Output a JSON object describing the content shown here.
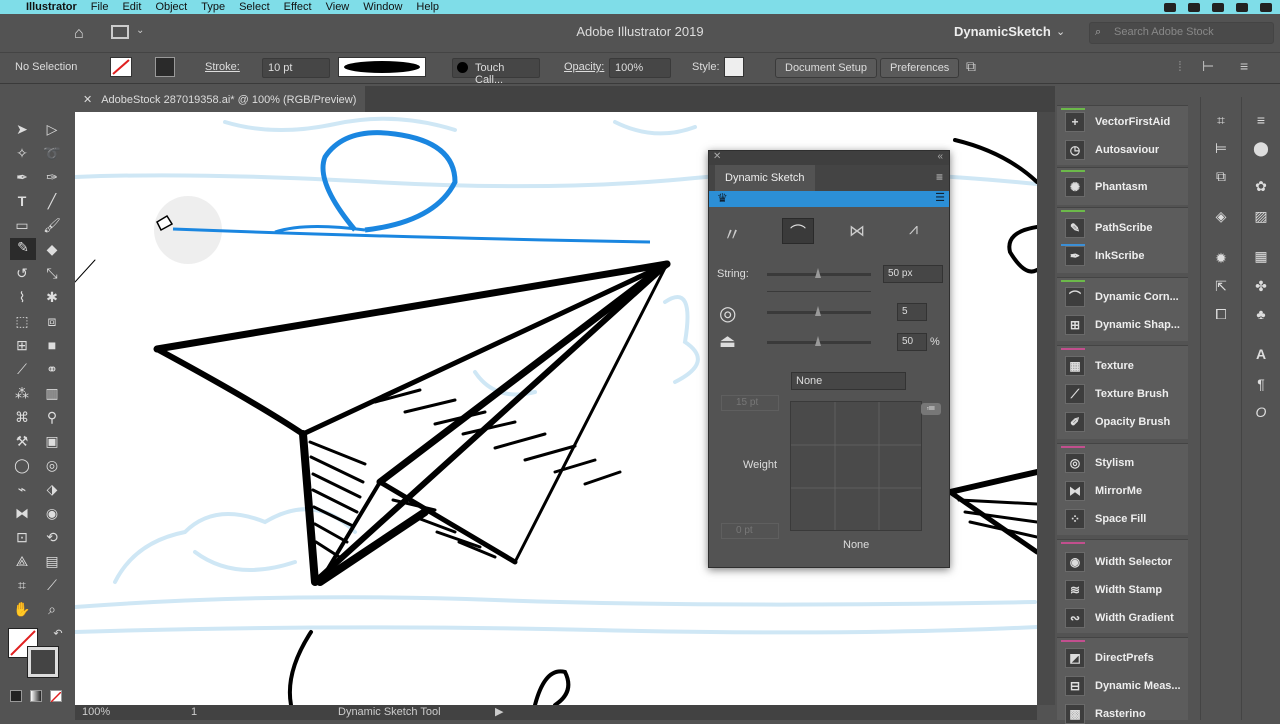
{
  "menubar": {
    "apple": "",
    "items": [
      "Illustrator",
      "File",
      "Edit",
      "Object",
      "Type",
      "Select",
      "Effect",
      "View",
      "Window",
      "Help"
    ]
  },
  "app": {
    "title": "Adobe Illustrator 2019",
    "workspace": "DynamicSketch",
    "search_placeholder": "Search Adobe Stock"
  },
  "control_bar": {
    "selection": "No Selection",
    "stroke_label": "Stroke:",
    "stroke_value": "10 pt",
    "brush": "Touch Call...",
    "opacity_label": "Opacity:",
    "opacity_value": "100%",
    "style_label": "Style:",
    "document_setup": "Document Setup",
    "preferences": "Preferences"
  },
  "document": {
    "tab_title": "AdobeStock 287019358.ai* @ 100% (RGB/Preview)"
  },
  "status_bar": {
    "zoom": "100%",
    "artboard": "1",
    "tool_name": "Dynamic Sketch Tool"
  },
  "dynamic_sketch": {
    "panel_title": "Dynamic Sketch",
    "string_label": "String:",
    "string_value": "50 px",
    "rings_value": "5",
    "iron_value": "50",
    "percent": "%",
    "profile_select": "None",
    "top_pt": "15 pt",
    "bottom_pt": "0 pt",
    "weight_label": "Weight",
    "graph_footer": "None"
  },
  "plugins": {
    "groups": [
      {
        "color": "#6cb94a",
        "items": [
          {
            "label": "VectorFirstAid",
            "icon": "+"
          },
          {
            "label": "Autosaviour",
            "icon": "◷"
          }
        ]
      },
      {
        "color": "#6cb94a",
        "items": [
          {
            "label": "Phantasm",
            "icon": "✺"
          }
        ]
      },
      {
        "color": "#3b8fd6",
        "items": [
          {
            "label": "PathScribe",
            "icon": "✎"
          },
          {
            "label": "InkScribe",
            "icon": "✒"
          }
        ]
      },
      {
        "color": "#6cb94a",
        "items": [
          {
            "label": "Dynamic Corn...",
            "icon": "⌒"
          },
          {
            "label": "Dynamic Shap...",
            "icon": "⊞"
          }
        ]
      },
      {
        "color": "#c24f8e",
        "items": [
          {
            "label": "Texture",
            "icon": "▦"
          },
          {
            "label": "Texture Brush",
            "icon": "⟋"
          },
          {
            "label": "Opacity Brush",
            "icon": "✐"
          }
        ]
      },
      {
        "color": "#c24f8e",
        "items": [
          {
            "label": "Stylism",
            "icon": "◎"
          },
          {
            "label": "MirrorMe",
            "icon": "⧓"
          },
          {
            "label": "Space Fill",
            "icon": "⁘"
          }
        ]
      },
      {
        "color": "#c24f8e",
        "items": [
          {
            "label": "Width Selector",
            "icon": "◉"
          },
          {
            "label": "Width Stamp",
            "icon": "≋"
          },
          {
            "label": "Width Gradient",
            "icon": "∾"
          }
        ]
      },
      {
        "color": "#c24f8e",
        "items": [
          {
            "label": "DirectPrefs",
            "icon": "◩"
          },
          {
            "label": "Dynamic Meas...",
            "icon": "⊟"
          },
          {
            "label": "Rasterino",
            "icon": "▩"
          }
        ]
      }
    ]
  },
  "colors": {
    "accent_blue": "#2c8fd6",
    "sketch_blue": "#1a86e0",
    "cloud_blue": "#cfe7f5"
  }
}
